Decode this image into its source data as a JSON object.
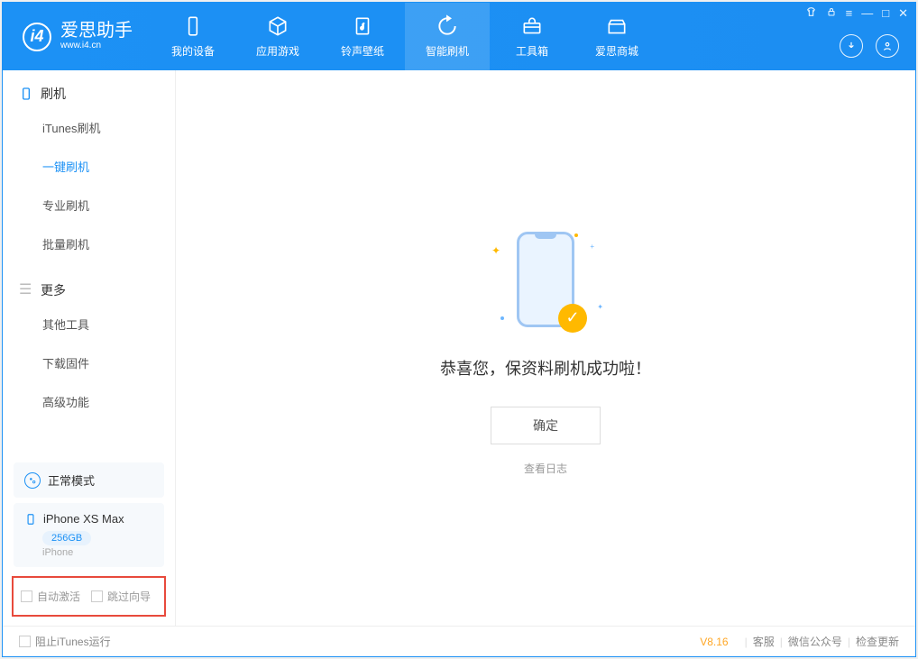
{
  "appName": "爱思助手",
  "appUrl": "www.i4.cn",
  "tabs": [
    {
      "label": "我的设备",
      "icon": "device"
    },
    {
      "label": "应用游戏",
      "icon": "cube"
    },
    {
      "label": "铃声壁纸",
      "icon": "music"
    },
    {
      "label": "智能刷机",
      "icon": "refresh",
      "active": true
    },
    {
      "label": "工具箱",
      "icon": "toolbox"
    },
    {
      "label": "爱思商城",
      "icon": "store"
    }
  ],
  "winControls": {
    "shirt": "⬡",
    "lock": "🔒",
    "menu": "≡",
    "min": "—",
    "max": "□",
    "close": "✕"
  },
  "sidebar": {
    "section1": {
      "title": "刷机",
      "items": [
        "iTunes刷机",
        "一键刷机",
        "专业刷机",
        "批量刷机"
      ],
      "activeIndex": 1
    },
    "section2": {
      "title": "更多",
      "items": [
        "其他工具",
        "下载固件",
        "高级功能"
      ]
    }
  },
  "statusCard": {
    "label": "正常模式"
  },
  "deviceCard": {
    "name": "iPhone XS Max",
    "storage": "256GB",
    "type": "iPhone"
  },
  "bottomChecks": {
    "auto": "自动激活",
    "skip": "跳过向导"
  },
  "main": {
    "successText": "恭喜您，保资料刷机成功啦！",
    "okButton": "确定",
    "logLink": "查看日志"
  },
  "footer": {
    "preventItunes": "阻止iTunes运行",
    "version": "V8.16",
    "links": [
      "客服",
      "微信公众号",
      "检查更新"
    ]
  }
}
